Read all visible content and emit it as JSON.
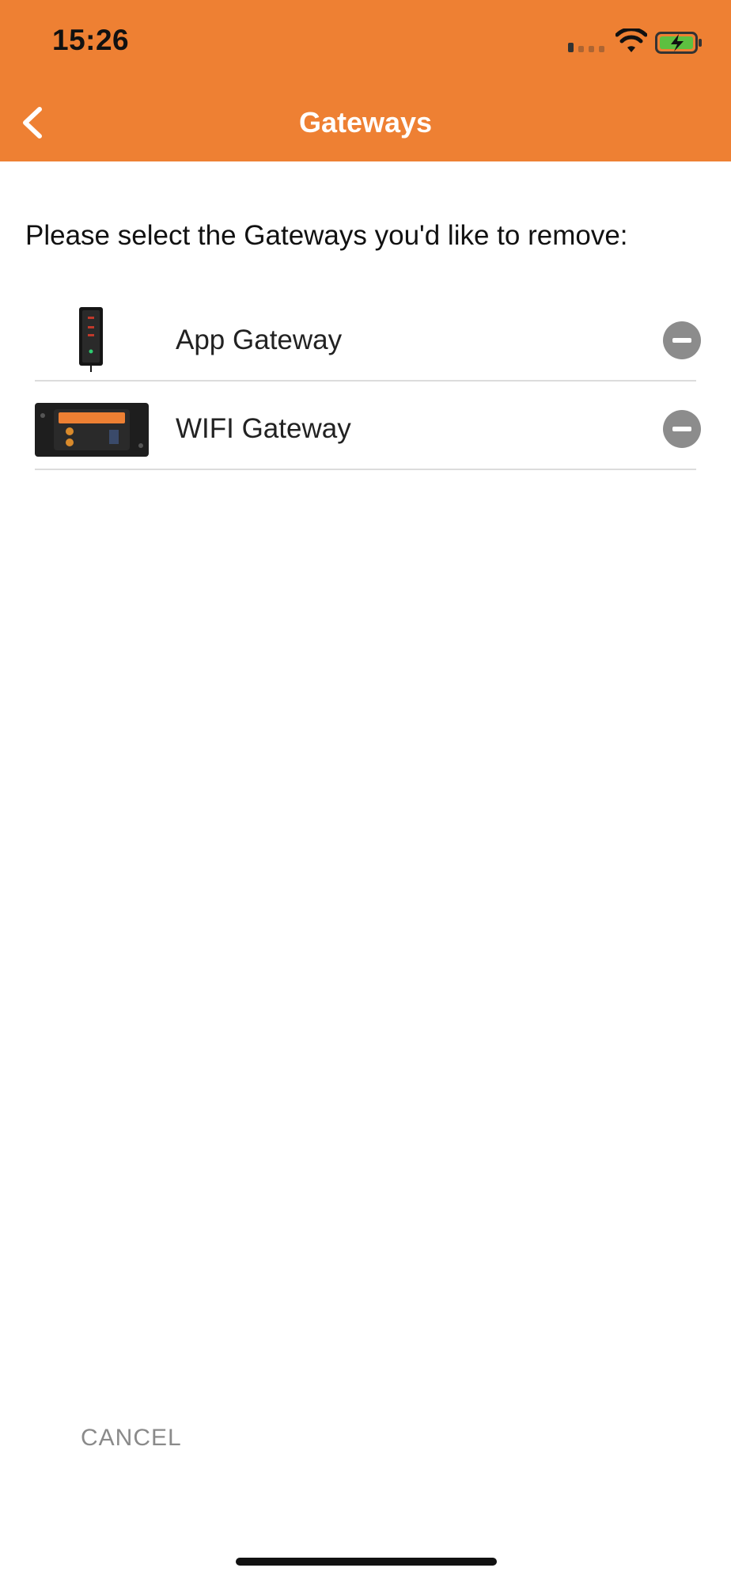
{
  "status_bar": {
    "time": "15:26"
  },
  "header": {
    "title": "Gateways"
  },
  "instruction": "Please select the Gateways you'd like to remove:",
  "gateways": [
    {
      "label": "App Gateway",
      "icon": "app-gateway-device-image"
    },
    {
      "label": "WIFI Gateway",
      "icon": "wifi-gateway-device-image"
    }
  ],
  "footer": {
    "cancel_label": "CANCEL"
  },
  "colors": {
    "accent": "#EE8033",
    "remove": "#8C8C8C",
    "cancel_text": "#8A8A8A"
  }
}
